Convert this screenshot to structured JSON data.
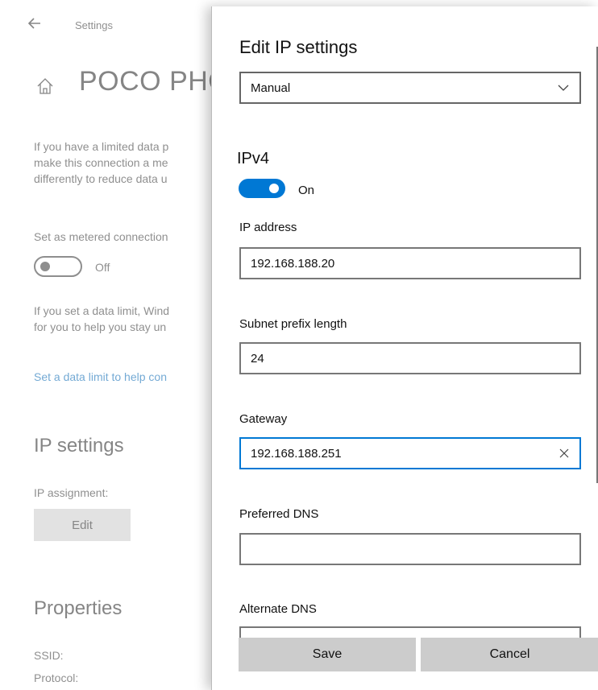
{
  "background": {
    "nav": {
      "title": "Settings"
    },
    "page_title": "POCO PHO",
    "description_lines": [
      "If you have a limited data p",
      "make this connection a me",
      "differently to reduce data u"
    ],
    "metered": {
      "label": "Set as metered connection",
      "toggle_state": "Off"
    },
    "data_limit_lines": [
      "If you set a data limit, Wind",
      "for you to help you stay un"
    ],
    "data_limit_link": "Set a data limit to help con",
    "ip_settings": {
      "heading": "IP settings",
      "assignment_label": "IP assignment:",
      "edit_label": "Edit"
    },
    "properties": {
      "heading": "Properties",
      "ssid_label": "SSID:",
      "protocol_label": "Protocol:"
    }
  },
  "dialog": {
    "title": "Edit IP settings",
    "mode_selected": "Manual",
    "ipv4": {
      "heading": "IPv4",
      "toggle_state": "On"
    },
    "fields": {
      "ip_address": {
        "label": "IP address",
        "value": "192.168.188.20"
      },
      "subnet": {
        "label": "Subnet prefix length",
        "value": "24"
      },
      "gateway": {
        "label": "Gateway",
        "value": "192.168.188.251"
      },
      "preferred_dns": {
        "label": "Preferred DNS",
        "value": ""
      },
      "alternate_dns": {
        "label": "Alternate DNS",
        "value": ""
      }
    },
    "buttons": {
      "save": "Save",
      "cancel": "Cancel"
    }
  },
  "colors": {
    "accent": "#0078d4",
    "link": "#0063b1",
    "button_bg": "#cccccc"
  },
  "icons": [
    "back-arrow-icon",
    "home-icon",
    "chevron-down-icon",
    "clear-icon"
  ]
}
